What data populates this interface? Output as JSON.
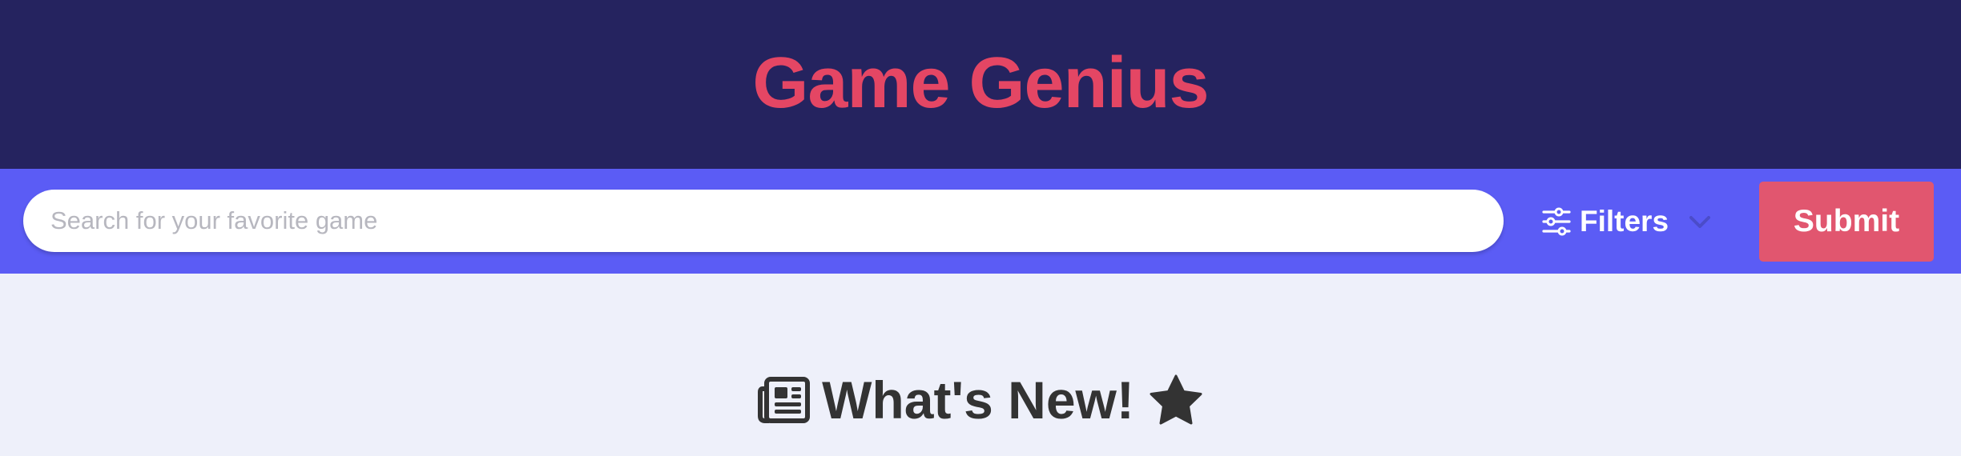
{
  "header": {
    "title": "Game Genius"
  },
  "search": {
    "placeholder": "Search for your favorite game",
    "value": ""
  },
  "filters": {
    "label": "Filters",
    "icon": "sliders-icon",
    "dropdown_icon": "chevron-down-icon"
  },
  "submit": {
    "label": "Submit"
  },
  "main": {
    "section_title": "What's New!",
    "leading_icon": "newspaper-icon",
    "trailing_icon": "star-icon"
  },
  "colors": {
    "header_bg": "#25235f",
    "title": "#e44664",
    "search_bar_bg": "#5b5cf5",
    "submit_bg": "#e1566f",
    "page_bg": "#eef0fa",
    "text_dark": "#333333"
  }
}
